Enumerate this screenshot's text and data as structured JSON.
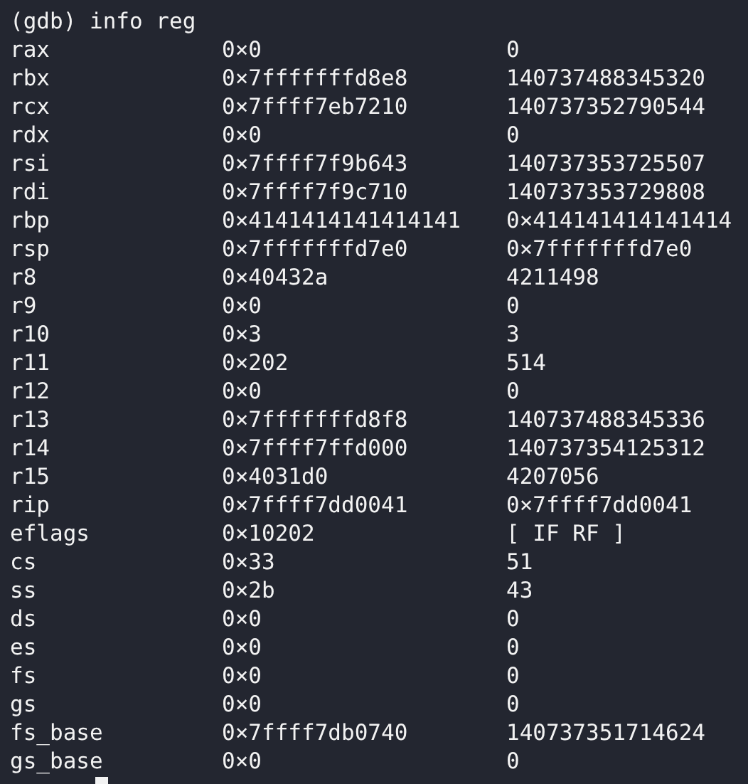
{
  "command_line": "(gdb) info reg",
  "registers": [
    {
      "name": "rax",
      "hex": "0×0",
      "natural": "0"
    },
    {
      "name": "rbx",
      "hex": "0×7fffffffd8e8",
      "natural": "140737488345320"
    },
    {
      "name": "rcx",
      "hex": "0×7ffff7eb7210",
      "natural": "140737352790544"
    },
    {
      "name": "rdx",
      "hex": "0×0",
      "natural": "0"
    },
    {
      "name": "rsi",
      "hex": "0×7ffff7f9b643",
      "natural": "140737353725507"
    },
    {
      "name": "rdi",
      "hex": "0×7ffff7f9c710",
      "natural": "140737353729808"
    },
    {
      "name": "rbp",
      "hex": "0×4141414141414141",
      "natural": "0×414141414141414"
    },
    {
      "name": "rsp",
      "hex": "0×7fffffffd7e0",
      "natural": "0×7fffffffd7e0"
    },
    {
      "name": "r8",
      "hex": "0×40432a",
      "natural": "4211498"
    },
    {
      "name": "r9",
      "hex": "0×0",
      "natural": "0"
    },
    {
      "name": "r10",
      "hex": "0×3",
      "natural": "3"
    },
    {
      "name": "r11",
      "hex": "0×202",
      "natural": "514"
    },
    {
      "name": "r12",
      "hex": "0×0",
      "natural": "0"
    },
    {
      "name": "r13",
      "hex": "0×7fffffffd8f8",
      "natural": "140737488345336"
    },
    {
      "name": "r14",
      "hex": "0×7ffff7ffd000",
      "natural": "140737354125312"
    },
    {
      "name": "r15",
      "hex": "0×4031d0",
      "natural": "4207056"
    },
    {
      "name": "rip",
      "hex": "0×7ffff7dd0041",
      "natural": "0×7ffff7dd0041"
    },
    {
      "name": "eflags",
      "hex": "0×10202",
      "natural": "[ IF RF ]"
    },
    {
      "name": "cs",
      "hex": "0×33",
      "natural": "51"
    },
    {
      "name": "ss",
      "hex": "0×2b",
      "natural": "43"
    },
    {
      "name": "ds",
      "hex": "0×0",
      "natural": "0"
    },
    {
      "name": "es",
      "hex": "0×0",
      "natural": "0"
    },
    {
      "name": "fs",
      "hex": "0×0",
      "natural": "0"
    },
    {
      "name": "gs",
      "hex": "0×0",
      "natural": "0"
    },
    {
      "name": "fs_base",
      "hex": "0×7ffff7db0740",
      "natural": "140737351714624"
    },
    {
      "name": "gs_base",
      "hex": "0×0",
      "natural": "0"
    }
  ]
}
